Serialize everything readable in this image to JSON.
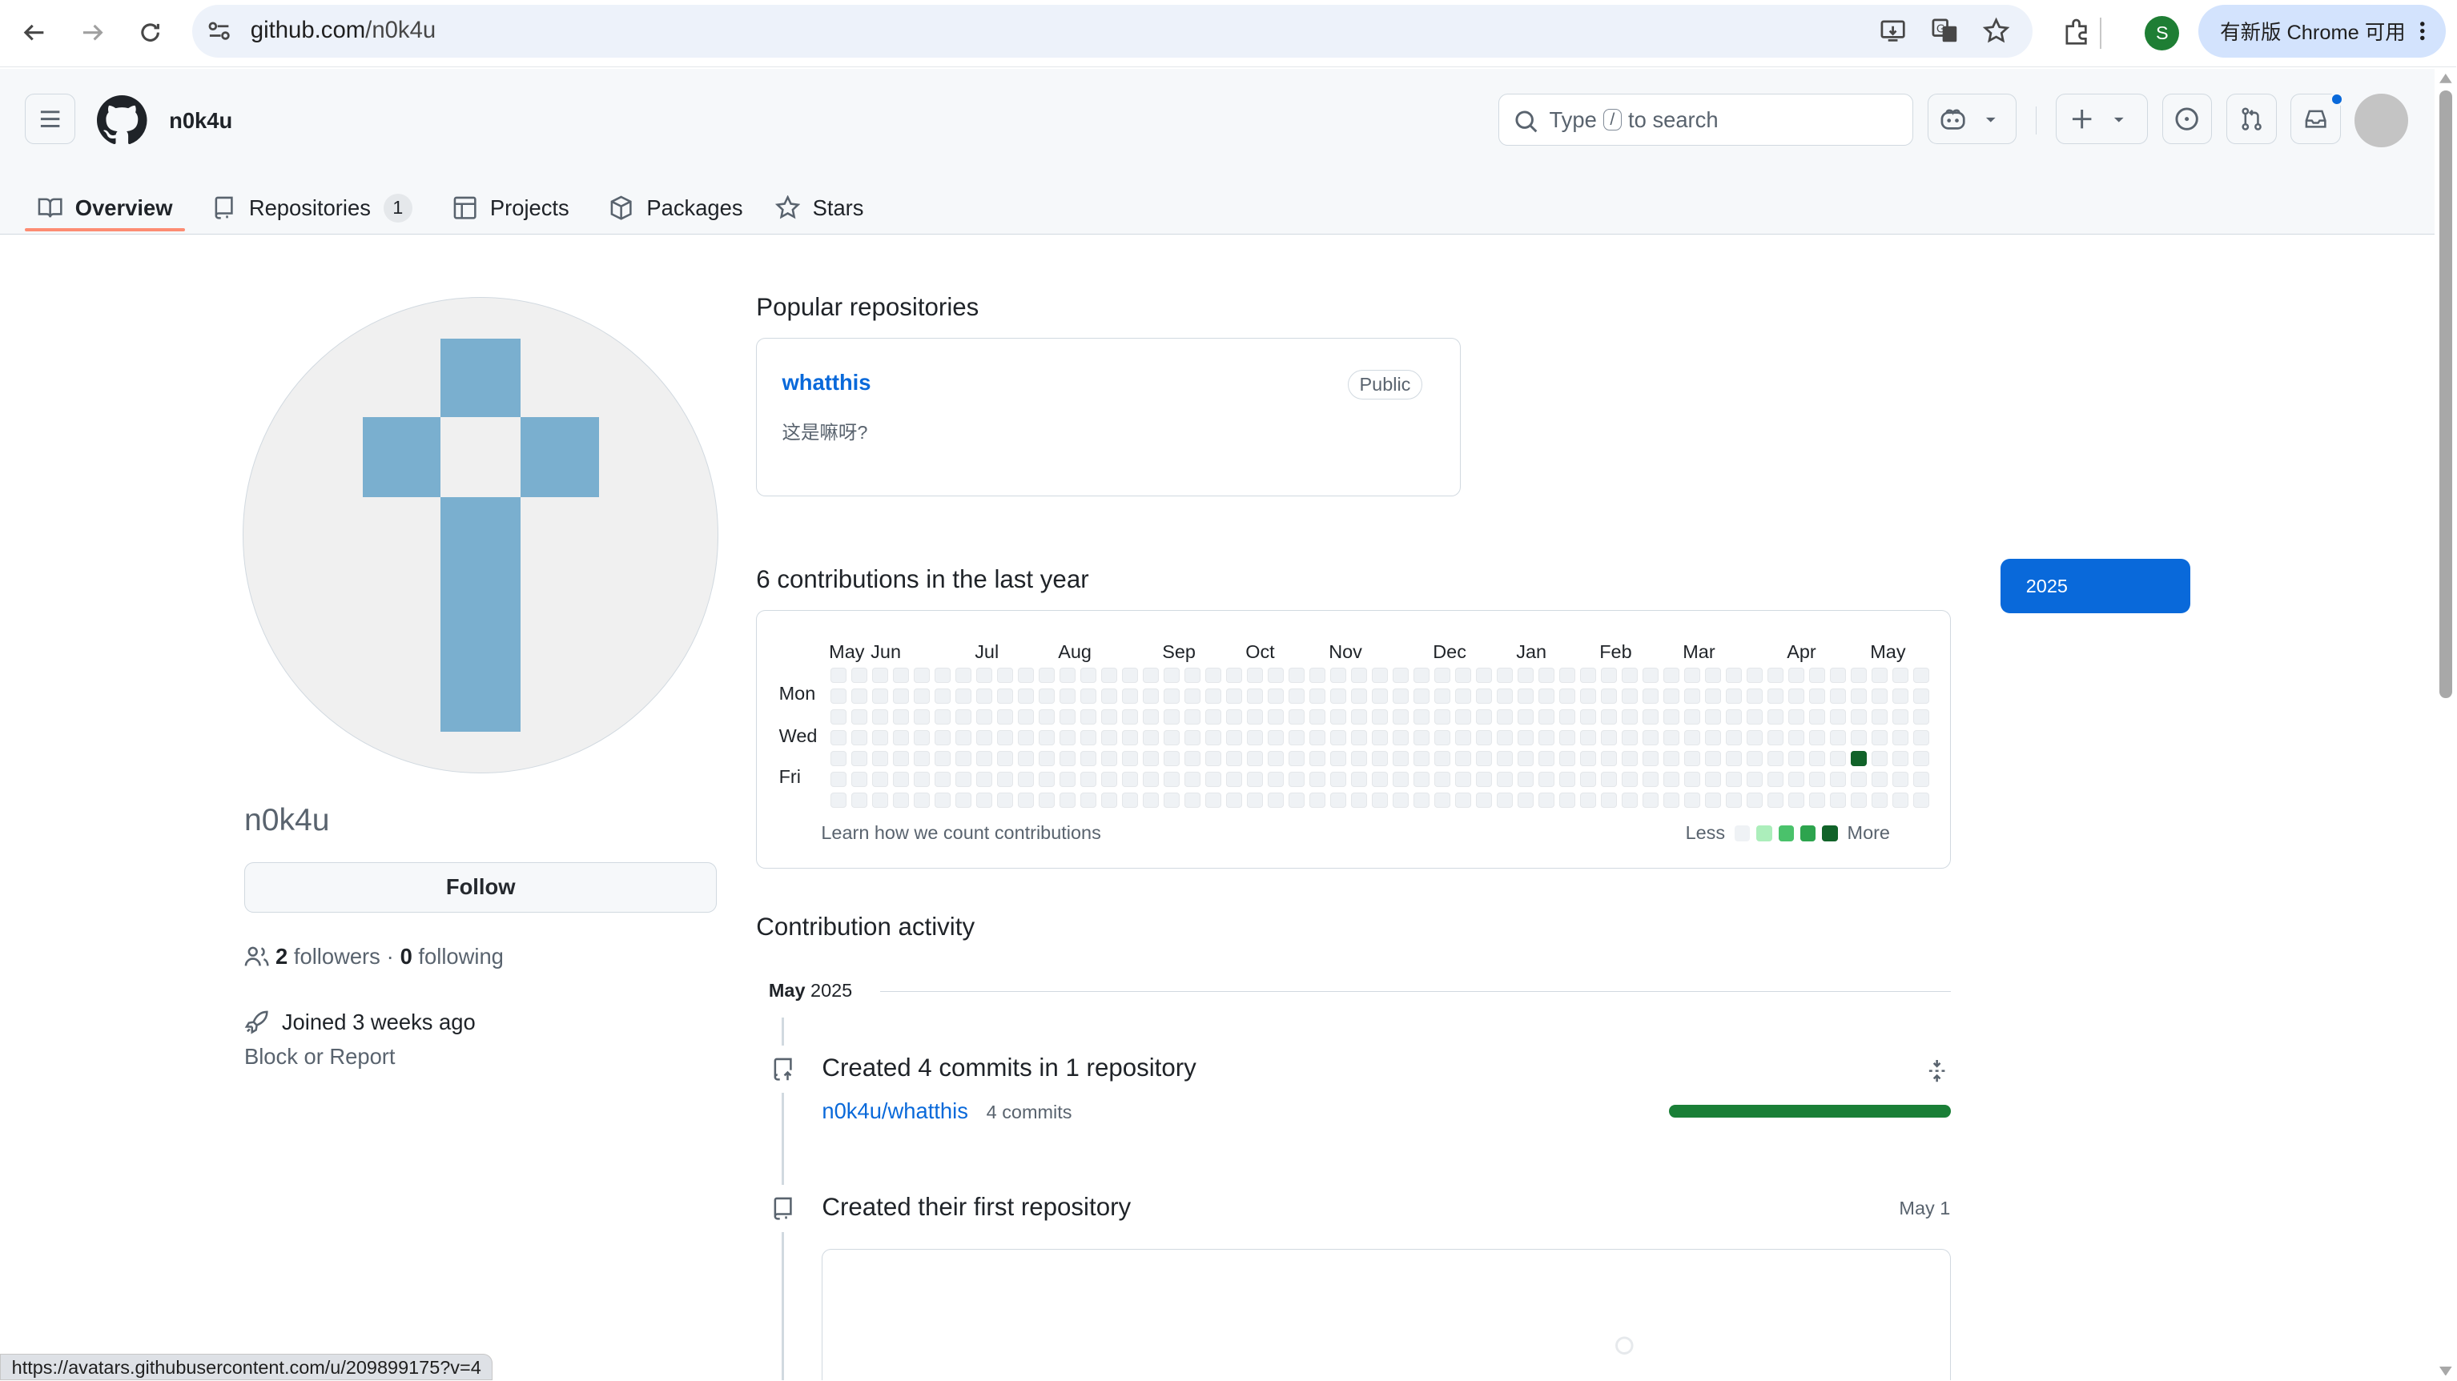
{
  "browser": {
    "url_host": "github.com",
    "url_path": "/n0k4u",
    "profile_initial": "S",
    "profile_color": "#1e7e34",
    "update_label": "有新版 Chrome 可用",
    "status_url": "https://avatars.githubusercontent.com/u/209899175?v=4"
  },
  "header": {
    "username": "n0k4u",
    "search_prefix": "Type",
    "search_key": "/",
    "search_suffix": "to search"
  },
  "tabs": [
    {
      "label": "Overview",
      "icon": "book-icon",
      "selected": true
    },
    {
      "label": "Repositories",
      "icon": "repo-icon",
      "count": "1"
    },
    {
      "label": "Projects",
      "icon": "table-icon"
    },
    {
      "label": "Packages",
      "icon": "package-icon"
    },
    {
      "label": "Stars",
      "icon": "star-icon"
    }
  ],
  "profile": {
    "login": "n0k4u",
    "follow_label": "Follow",
    "followers_count": "2",
    "followers_label": "followers",
    "separator": "·",
    "following_count": "0",
    "following_label": "following",
    "joined": "Joined 3 weeks ago",
    "block_label": "Block or Report"
  },
  "popular": {
    "heading": "Popular repositories",
    "repos": [
      {
        "name": "whatthis",
        "visibility": "Public",
        "description": "这是嘛呀?"
      }
    ]
  },
  "contributions": {
    "heading": "6 contributions in the last year",
    "learn_label": "Learn how we count contributions",
    "less_label": "Less",
    "more_label": "More",
    "year_button": "2025",
    "level_colors": [
      "#eff2f5",
      "#aceebb",
      "#4ac26b",
      "#2da44e",
      "#116329"
    ]
  },
  "chart_data": {
    "type": "heatmap",
    "title": "6 contributions in the last year",
    "months": [
      "May",
      "Jun",
      "Jul",
      "Aug",
      "Sep",
      "Oct",
      "Nov",
      "Dec",
      "Jan",
      "Feb",
      "Mar",
      "Apr",
      "May"
    ],
    "day_labels": [
      "Mon",
      "Wed",
      "Fri"
    ],
    "weeks": 53,
    "days_per_week": 7,
    "active_cells": [
      {
        "week": 49,
        "day": 4,
        "level": 4
      }
    ],
    "total": 6
  },
  "activity": {
    "heading": "Contribution activity",
    "month": "May",
    "year": "2025",
    "commits_title": "Created 4 commits in 1 repository",
    "commit_repo": "n0k4u/whatthis",
    "commit_repo_count": "4 commits",
    "first_repo_title": "Created their first repository",
    "first_repo_date": "May 1"
  }
}
